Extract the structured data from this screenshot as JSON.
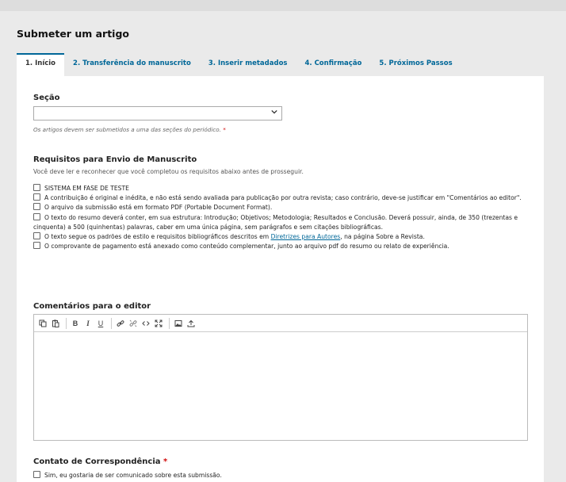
{
  "page": {
    "title": "Submeter um artigo"
  },
  "tabs": [
    {
      "label": "1. Início"
    },
    {
      "label": "2. Transferência do manuscrito"
    },
    {
      "label": "3. Inserir metadados"
    },
    {
      "label": "4. Confirmação"
    },
    {
      "label": "5. Próximos Passos"
    }
  ],
  "section": {
    "label": "Seção",
    "value": "",
    "help": "Os artigos devem ser submetidos a uma das seções do periódico.",
    "required_mark": "*"
  },
  "requirements": {
    "title": "Requisitos para Envio de Manuscrito",
    "description": "Você deve ler e reconhecer que você completou os requisitos abaixo antes de prosseguir.",
    "items": [
      {
        "text": "SISTEMA EM FASE DE TESTE"
      },
      {
        "text": "A contribuição é original e inédita, e não está sendo avaliada para publicação por outra revista; caso contrário, deve-se justificar em \"Comentários ao editor\"."
      },
      {
        "text": "O arquivo da submissão está em formato PDF (Portable Document Format)."
      },
      {
        "text": "O texto do resumo deverá conter, em sua estrutura: Introdução; Objetivos; Metodologia; Resultados e Conclusão. Deverá possuir, ainda, de 350 (trezentas e cinquenta) a 500 (quinhentas) palavras, caber em uma única página, sem parágrafos e sem citações bibliográficas."
      },
      {
        "text_before": "O texto segue os padrões de estilo e requisitos bibliográficos descritos em ",
        "link": "Diretrizes para Autores",
        "text_after": ", na página Sobre a Revista."
      },
      {
        "text": "O comprovante de pagamento está anexado como conteúdo complementar, junto ao arquivo pdf do resumo ou relato de experiência."
      }
    ]
  },
  "comments": {
    "label": "Comentários para o editor",
    "value": "",
    "toolbar_icons": [
      "copy-icon",
      "paste-icon",
      "bold-icon",
      "italic-icon",
      "underline-icon",
      "link-icon",
      "unlink-icon",
      "code-icon",
      "fullscreen-icon",
      "image-icon",
      "upload-icon"
    ],
    "bold_glyph": "B",
    "italic_glyph": "I",
    "underline_glyph": "U"
  },
  "contact": {
    "label": "Contato de Correspondência",
    "required_mark": "*",
    "checkbox_text": "Sim, eu gostaria de ser comunicado sobre esta submissão."
  }
}
